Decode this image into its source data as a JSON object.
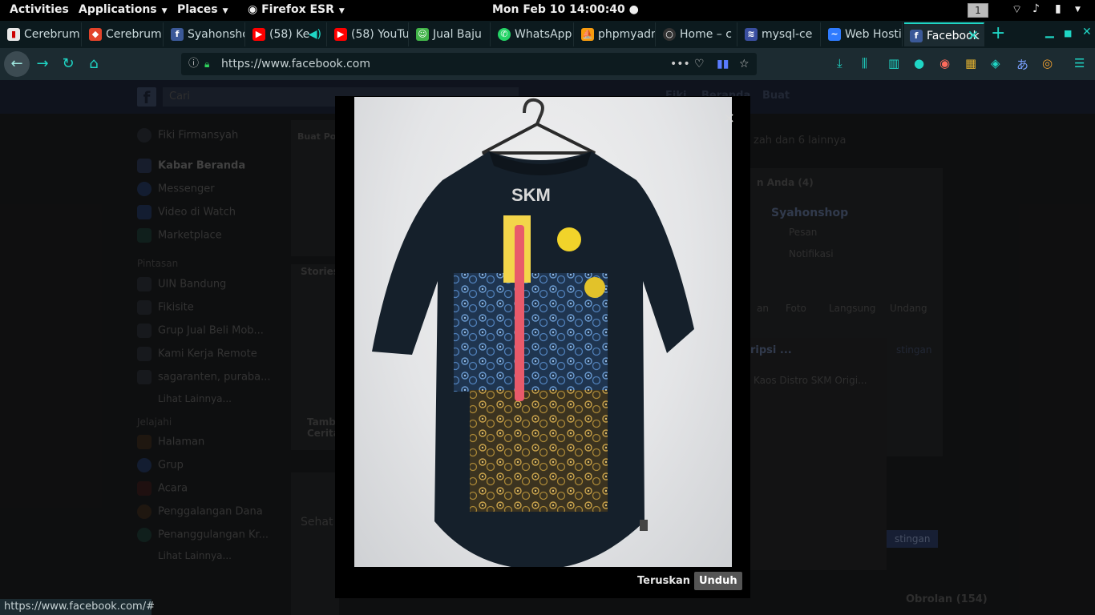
{
  "gnome": {
    "activities": "Activities",
    "applications": "Applications",
    "places": "Places",
    "app_name": "Firefox ESR",
    "clock": "Mon Feb 10  14:00:40",
    "workspace": "1"
  },
  "tabs": [
    {
      "label": "Cerebrum",
      "icon": "trello-icon",
      "color": "#e8e8e8"
    },
    {
      "label": "Cerebrum",
      "icon": "gitlab-icon",
      "color": "#e2432a"
    },
    {
      "label": "Syahonshop",
      "icon": "facebook-icon",
      "color": "#3b5998"
    },
    {
      "label": "(58) Ke",
      "icon": "youtube-icon",
      "color": "#ff0000"
    },
    {
      "label": "(58) YouTube",
      "icon": "youtube-icon",
      "color": "#ff0000"
    },
    {
      "label": "Jual Baju",
      "icon": "tokopedia-icon",
      "color": "#42b549"
    },
    {
      "label": "WhatsApp",
      "icon": "whatsapp-icon",
      "color": "#25d366"
    },
    {
      "label": "phpmyadmin",
      "icon": "phpmyadmin-icon",
      "color": "#f89c0e"
    },
    {
      "label": "Home – c",
      "icon": "github-icon",
      "color": "#888888"
    },
    {
      "label": "mysql-ce",
      "icon": "stack-icon",
      "color": "#6a8cff"
    },
    {
      "label": "Web Hosting",
      "icon": "chart-icon",
      "color": "#2f7bff"
    },
    {
      "label": "Facebook",
      "icon": "facebook-icon",
      "color": "#3b5998"
    }
  ],
  "navbar": {
    "url": "https://www.facebook.com"
  },
  "fb": {
    "search_placeholder": "Cari",
    "top_links": [
      "Fiki",
      "Beranda",
      "Buat"
    ],
    "user_name": "Fiki Firmansyah",
    "nav_items": [
      "Kabar Beranda",
      "Messenger",
      "Video di Watch",
      "Marketplace"
    ],
    "shortcuts_title": "Pintasan",
    "shortcuts": [
      "UIN Bandung",
      "Fikisite",
      "Grup Jual Beli Mob...",
      "Kami Kerja Remote",
      "sagaranten, puraba..."
    ],
    "see_more": "Lihat Lainnya...",
    "explore_title": "Jelajahi",
    "explore": [
      "Halaman",
      "Grup",
      "Acara",
      "Penggalangan Dana",
      "Penanggulangan Kr..."
    ],
    "create_post": "Buat Po",
    "stories": "Stories",
    "story_caption": "Tamb Cerita",
    "sehat": "Sehat",
    "right_friends": "zah dan 6 lainnya",
    "right_pages": "n Anda (4)",
    "page_name": "Syahonshop",
    "page_msg": "Pesan",
    "page_notif": "Notifikasi",
    "page_actions": [
      "an",
      "Foto",
      "Langsung",
      "Undang"
    ],
    "chat_title": "ripsi ...",
    "chat_product": "Kaos Distro SKM Origi...",
    "chat_settings": "stingan",
    "chat_bottom": "stingan",
    "chat_dock": "Obrolan (154)"
  },
  "viewer": {
    "close": "×",
    "forward_label": "Teruskan",
    "download_label": "Unduh"
  },
  "status_url": "https://www.facebook.com/#"
}
